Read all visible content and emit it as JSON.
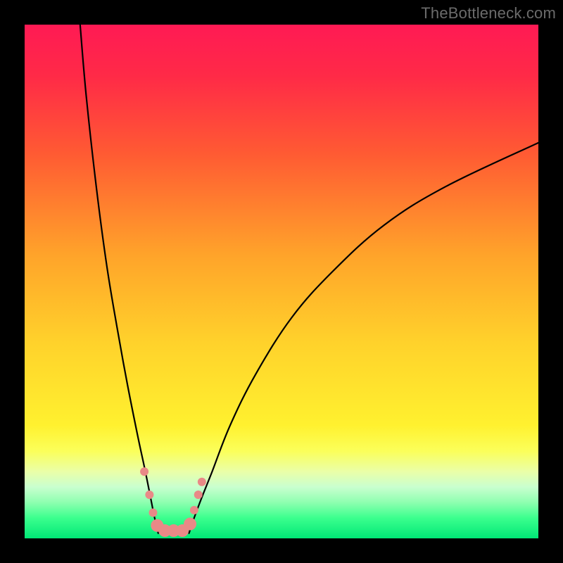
{
  "watermark": "TheBottleneck.com",
  "chart_data": {
    "type": "line",
    "title": "",
    "xlabel": "",
    "ylabel": "",
    "xlim": [
      0,
      100
    ],
    "ylim": [
      0,
      100
    ],
    "background_gradient": {
      "stops": [
        {
          "offset": 0.0,
          "color": "#ff1a54"
        },
        {
          "offset": 0.1,
          "color": "#ff2a47"
        },
        {
          "offset": 0.25,
          "color": "#ff5a33"
        },
        {
          "offset": 0.45,
          "color": "#ffa42a"
        },
        {
          "offset": 0.62,
          "color": "#ffd22b"
        },
        {
          "offset": 0.78,
          "color": "#fff12f"
        },
        {
          "offset": 0.83,
          "color": "#fbff5a"
        },
        {
          "offset": 0.87,
          "color": "#eaffa8"
        },
        {
          "offset": 0.9,
          "color": "#c9ffcf"
        },
        {
          "offset": 0.93,
          "color": "#8effb0"
        },
        {
          "offset": 0.96,
          "color": "#3cff8e"
        },
        {
          "offset": 1.0,
          "color": "#00e876"
        }
      ]
    },
    "series": [
      {
        "name": "bottleneck-curve-left",
        "x": [
          10.8,
          12.0,
          14.0,
          16.0,
          18.0,
          20.0,
          22.0,
          23.5,
          24.5,
          25.3,
          26.0
        ],
        "y": [
          100.0,
          86.0,
          68.0,
          53.0,
          41.0,
          30.0,
          20.0,
          13.0,
          8.0,
          4.0,
          1.0
        ]
      },
      {
        "name": "bottleneck-curve-right",
        "x": [
          32.0,
          33.0,
          34.5,
          36.5,
          40.0,
          45.0,
          52.0,
          60.0,
          70.0,
          82.0,
          100.0
        ],
        "y": [
          1.0,
          4.0,
          8.0,
          13.0,
          22.0,
          32.0,
          43.0,
          52.0,
          61.0,
          68.5,
          77.0
        ]
      }
    ],
    "markers": {
      "name": "highlight-markers",
      "color": "#e98987",
      "radius_small": 6,
      "radius_large": 9,
      "points": [
        {
          "x": 23.3,
          "y": 13.0,
          "r": "small"
        },
        {
          "x": 24.3,
          "y": 8.5,
          "r": "small"
        },
        {
          "x": 25.0,
          "y": 5.0,
          "r": "small"
        },
        {
          "x": 25.8,
          "y": 2.5,
          "r": "large"
        },
        {
          "x": 27.3,
          "y": 1.5,
          "r": "large"
        },
        {
          "x": 29.0,
          "y": 1.5,
          "r": "large"
        },
        {
          "x": 30.7,
          "y": 1.5,
          "r": "large"
        },
        {
          "x": 32.2,
          "y": 2.8,
          "r": "large"
        },
        {
          "x": 33.0,
          "y": 5.5,
          "r": "small"
        },
        {
          "x": 33.8,
          "y": 8.5,
          "r": "small"
        },
        {
          "x": 34.5,
          "y": 11.0,
          "r": "small"
        }
      ]
    }
  }
}
